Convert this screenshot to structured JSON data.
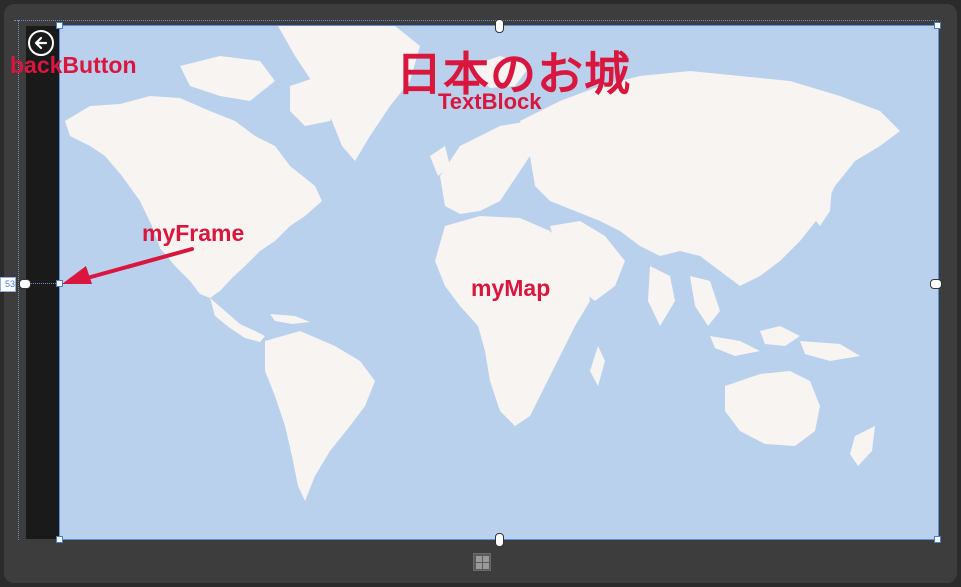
{
  "page": {
    "title": "日本のお城",
    "margin_value": "53"
  },
  "annotations": {
    "back_button": "backButton",
    "text_block": "TextBlock",
    "frame": "myFrame",
    "map": "myMap"
  },
  "icons": {
    "back": "back-arrow-icon",
    "windows": "windows-logo-icon"
  },
  "colors": {
    "annotation": "#d9163e",
    "ocean": "#bad1ed",
    "land": "#f7f4f2",
    "selection": "#5b8fd6"
  }
}
